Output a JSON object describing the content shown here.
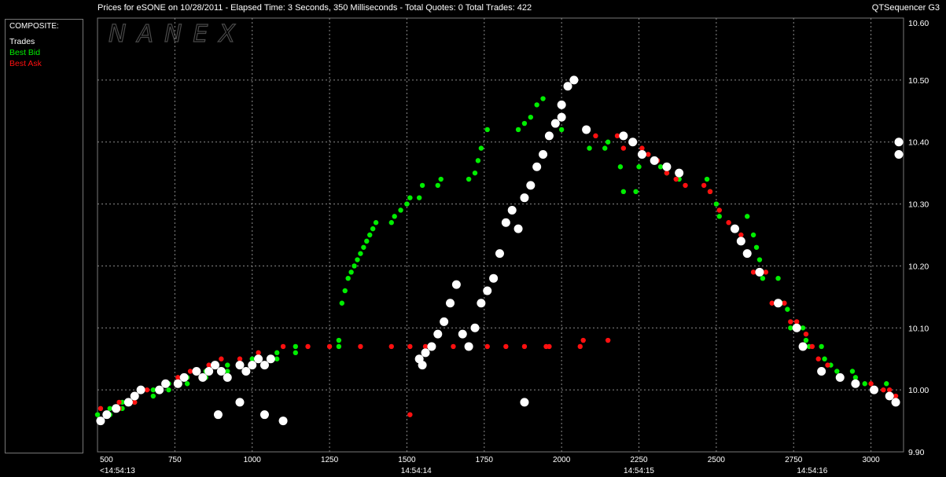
{
  "header": {
    "title": "Prices for  eSONE  on  10/28/2011  -  Elapsed Time: 3 Seconds, 350 Milliseconds  -  Total Quotes: 0  Total Trades: 422",
    "app_name": "QTSequencer G3"
  },
  "legend": {
    "header": "COMPOSITE:",
    "items": [
      {
        "label": "Trades",
        "color": "#ffffff"
      },
      {
        "label": "Best Bid",
        "color": "#00ee00"
      },
      {
        "label": "Best Ask",
        "color": "#ff1010"
      }
    ]
  },
  "watermark": "NANEX",
  "chart_data": {
    "type": "scatter",
    "title": "",
    "xlim": [
      500,
      3090
    ],
    "ylim": [
      9.9,
      10.6
    ],
    "x_ticks": [
      "500",
      "750",
      "1000",
      "1250",
      "1500",
      "1750",
      "2000",
      "2250",
      "2500",
      "2750",
      "3000"
    ],
    "y_ticks": [
      "10.60",
      "10.50",
      "10.40",
      "10.30",
      "10.20",
      "10.10",
      "10.00",
      "9.90"
    ],
    "time_labels": [
      {
        "x": 500,
        "label": "<14:54:13"
      },
      {
        "x": 1530,
        "label": "14:54:14"
      },
      {
        "x": 2250,
        "label": "14:54:15"
      },
      {
        "x": 2810,
        "label": "14:54:16"
      }
    ],
    "grid": true,
    "series": [
      {
        "name": "Best Bid",
        "color": "#00ee00",
        "points": [
          [
            500,
            9.96
          ],
          [
            540,
            9.96
          ],
          [
            540,
            9.97
          ],
          [
            580,
            9.97
          ],
          [
            580,
            9.98
          ],
          [
            620,
            9.98
          ],
          [
            620,
            9.99
          ],
          [
            680,
            9.99
          ],
          [
            680,
            10.0
          ],
          [
            730,
            10.0
          ],
          [
            730,
            10.01
          ],
          [
            790,
            10.01
          ],
          [
            790,
            10.02
          ],
          [
            850,
            10.02
          ],
          [
            850,
            10.03
          ],
          [
            920,
            10.03
          ],
          [
            920,
            10.04
          ],
          [
            1000,
            10.04
          ],
          [
            1000,
            10.05
          ],
          [
            1080,
            10.05
          ],
          [
            1080,
            10.06
          ],
          [
            1140,
            10.06
          ],
          [
            1140,
            10.07
          ],
          [
            1280,
            10.07
          ],
          [
            1280,
            10.08
          ],
          [
            1290,
            10.14
          ],
          [
            1300,
            10.16
          ],
          [
            1310,
            10.18
          ],
          [
            1320,
            10.19
          ],
          [
            1330,
            10.2
          ],
          [
            1340,
            10.21
          ],
          [
            1350,
            10.22
          ],
          [
            1360,
            10.23
          ],
          [
            1370,
            10.24
          ],
          [
            1380,
            10.25
          ],
          [
            1390,
            10.26
          ],
          [
            1400,
            10.27
          ],
          [
            1450,
            10.27
          ],
          [
            1460,
            10.28
          ],
          [
            1480,
            10.29
          ],
          [
            1500,
            10.3
          ],
          [
            1510,
            10.31
          ],
          [
            1540,
            10.31
          ],
          [
            1550,
            10.33
          ],
          [
            1600,
            10.33
          ],
          [
            1610,
            10.34
          ],
          [
            1700,
            10.34
          ],
          [
            1720,
            10.35
          ],
          [
            1730,
            10.37
          ],
          [
            1740,
            10.39
          ],
          [
            1760,
            10.42
          ],
          [
            1860,
            10.42
          ],
          [
            1880,
            10.43
          ],
          [
            1900,
            10.44
          ],
          [
            1920,
            10.46
          ],
          [
            1940,
            10.47
          ],
          [
            2000,
            10.42
          ],
          [
            2080,
            10.42
          ],
          [
            2090,
            10.39
          ],
          [
            2140,
            10.39
          ],
          [
            2150,
            10.4
          ],
          [
            2190,
            10.36
          ],
          [
            2200,
            10.32
          ],
          [
            2240,
            10.32
          ],
          [
            2250,
            10.36
          ],
          [
            2320,
            10.36
          ],
          [
            2340,
            10.35
          ],
          [
            2380,
            10.34
          ],
          [
            2470,
            10.34
          ],
          [
            2480,
            10.32
          ],
          [
            2500,
            10.3
          ],
          [
            2510,
            10.28
          ],
          [
            2600,
            10.28
          ],
          [
            2620,
            10.25
          ],
          [
            2630,
            10.23
          ],
          [
            2640,
            10.21
          ],
          [
            2650,
            10.18
          ],
          [
            2700,
            10.18
          ],
          [
            2710,
            10.14
          ],
          [
            2730,
            10.13
          ],
          [
            2740,
            10.1
          ],
          [
            2780,
            10.1
          ],
          [
            2790,
            10.08
          ],
          [
            2800,
            10.07
          ],
          [
            2840,
            10.07
          ],
          [
            2850,
            10.05
          ],
          [
            2870,
            10.04
          ],
          [
            2890,
            10.03
          ],
          [
            2940,
            10.03
          ],
          [
            2950,
            10.02
          ],
          [
            2980,
            10.01
          ],
          [
            3050,
            10.01
          ],
          [
            3060,
            9.99
          ],
          [
            3080,
            9.98
          ]
        ]
      },
      {
        "name": "Best Ask",
        "color": "#ff1010",
        "points": [
          [
            510,
            9.97
          ],
          [
            570,
            9.97
          ],
          [
            570,
            9.98
          ],
          [
            620,
            9.98
          ],
          [
            660,
            10.0
          ],
          [
            700,
            10.0
          ],
          [
            760,
            10.02
          ],
          [
            800,
            10.03
          ],
          [
            860,
            10.04
          ],
          [
            900,
            10.05
          ],
          [
            960,
            10.05
          ],
          [
            1020,
            10.06
          ],
          [
            1100,
            10.07
          ],
          [
            1180,
            10.07
          ],
          [
            1250,
            10.07
          ],
          [
            1350,
            10.07
          ],
          [
            1450,
            10.07
          ],
          [
            1510,
            10.07
          ],
          [
            1560,
            10.07
          ],
          [
            1650,
            10.07
          ],
          [
            1700,
            10.07
          ],
          [
            1760,
            10.07
          ],
          [
            1820,
            10.07
          ],
          [
            1880,
            10.07
          ],
          [
            1960,
            10.07
          ],
          [
            2060,
            10.07
          ],
          [
            2070,
            10.08
          ],
          [
            2150,
            10.08
          ],
          [
            2110,
            10.41
          ],
          [
            2180,
            10.41
          ],
          [
            2200,
            10.39
          ],
          [
            2260,
            10.39
          ],
          [
            2280,
            10.38
          ],
          [
            2310,
            10.37
          ],
          [
            2340,
            10.35
          ],
          [
            2370,
            10.34
          ],
          [
            2400,
            10.33
          ],
          [
            2460,
            10.33
          ],
          [
            2480,
            10.32
          ],
          [
            2510,
            10.29
          ],
          [
            2540,
            10.27
          ],
          [
            2580,
            10.25
          ],
          [
            2620,
            10.19
          ],
          [
            2660,
            10.19
          ],
          [
            2680,
            10.14
          ],
          [
            2720,
            10.14
          ],
          [
            2740,
            10.11
          ],
          [
            2760,
            10.11
          ],
          [
            2790,
            10.09
          ],
          [
            2810,
            10.07
          ],
          [
            2830,
            10.05
          ],
          [
            2860,
            10.04
          ],
          [
            2900,
            10.02
          ],
          [
            2950,
            10.01
          ],
          [
            3000,
            10.01
          ],
          [
            3040,
            10.0
          ],
          [
            3060,
            10.0
          ],
          [
            3080,
            9.99
          ],
          [
            1510,
            9.96
          ],
          [
            1950,
            10.07
          ]
        ]
      },
      {
        "name": "Trades",
        "color": "#ffffff",
        "points": [
          [
            510,
            9.95
          ],
          [
            530,
            9.96
          ],
          [
            560,
            9.97
          ],
          [
            600,
            9.98
          ],
          [
            620,
            9.99
          ],
          [
            640,
            10.0
          ],
          [
            700,
            10.0
          ],
          [
            720,
            10.01
          ],
          [
            760,
            10.01
          ],
          [
            780,
            10.02
          ],
          [
            820,
            10.03
          ],
          [
            840,
            10.02
          ],
          [
            860,
            10.03
          ],
          [
            880,
            10.04
          ],
          [
            900,
            10.03
          ],
          [
            920,
            10.02
          ],
          [
            960,
            10.04
          ],
          [
            980,
            10.03
          ],
          [
            1000,
            10.04
          ],
          [
            1020,
            10.05
          ],
          [
            1040,
            10.04
          ],
          [
            1060,
            10.05
          ],
          [
            890,
            9.96
          ],
          [
            960,
            9.98
          ],
          [
            1040,
            9.96
          ],
          [
            1100,
            9.95
          ],
          [
            1540,
            10.05
          ],
          [
            1550,
            10.04
          ],
          [
            1560,
            10.06
          ],
          [
            1580,
            10.07
          ],
          [
            1600,
            10.09
          ],
          [
            1620,
            10.11
          ],
          [
            1640,
            10.14
          ],
          [
            1660,
            10.17
          ],
          [
            1680,
            10.09
          ],
          [
            1700,
            10.07
          ],
          [
            1720,
            10.1
          ],
          [
            1740,
            10.14
          ],
          [
            1760,
            10.16
          ],
          [
            1780,
            10.18
          ],
          [
            1800,
            10.22
          ],
          [
            1820,
            10.27
          ],
          [
            1840,
            10.29
          ],
          [
            1860,
            10.26
          ],
          [
            1880,
            10.31
          ],
          [
            1880,
            9.98
          ],
          [
            1900,
            10.33
          ],
          [
            1920,
            10.36
          ],
          [
            1940,
            10.38
          ],
          [
            1960,
            10.41
          ],
          [
            1980,
            10.43
          ],
          [
            2000,
            10.46
          ],
          [
            2020,
            10.49
          ],
          [
            2040,
            10.5
          ],
          [
            2000,
            10.44
          ],
          [
            2080,
            10.42
          ],
          [
            2200,
            10.41
          ],
          [
            2230,
            10.4
          ],
          [
            2260,
            10.38
          ],
          [
            2300,
            10.37
          ],
          [
            2340,
            10.36
          ],
          [
            2380,
            10.35
          ],
          [
            2560,
            10.26
          ],
          [
            2580,
            10.24
          ],
          [
            2600,
            10.22
          ],
          [
            2640,
            10.19
          ],
          [
            2700,
            10.14
          ],
          [
            2760,
            10.1
          ],
          [
            2780,
            10.07
          ],
          [
            2840,
            10.03
          ],
          [
            2900,
            10.02
          ],
          [
            2950,
            10.01
          ],
          [
            3010,
            10.0
          ],
          [
            3060,
            9.99
          ],
          [
            3080,
            9.98
          ],
          [
            3090,
            10.38
          ],
          [
            3090,
            10.4
          ]
        ]
      }
    ]
  }
}
